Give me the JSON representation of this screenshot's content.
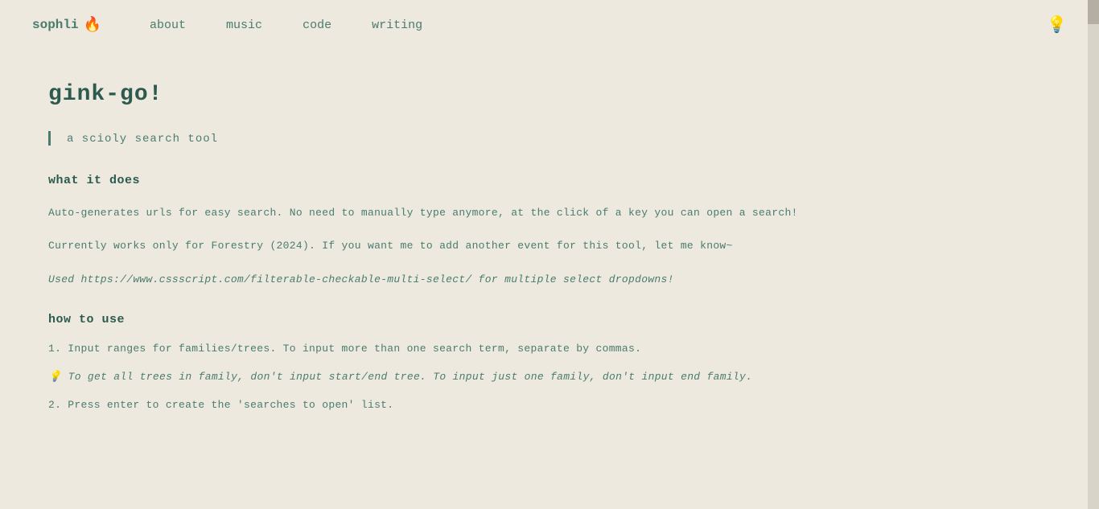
{
  "nav": {
    "brand": "sophli",
    "brand_emoji": "🔥",
    "links": [
      {
        "label": "about",
        "href": "#about"
      },
      {
        "label": "music",
        "href": "#music"
      },
      {
        "label": "code",
        "href": "#code"
      },
      {
        "label": "writing",
        "href": "#writing"
      }
    ],
    "theme_icon": "💡"
  },
  "page": {
    "title": "gink-go!",
    "subtitle": "a scioly search tool",
    "sections": [
      {
        "heading": "what it does",
        "paragraphs": [
          "Auto-generates urls for easy search. No need to manually type anymore, at the click of a key you can open a search!",
          "Currently works only for Forestry (2024). If you want me to add another event for this tool, let me know~",
          "Used https://www.cssscript.com/filterable-checkable-multi-select/ for multiple select dropdowns!"
        ]
      },
      {
        "heading": "how to use",
        "steps": [
          "1. Input ranges for families/trees. To input more than one search term, separate by commas.",
          "2. Press enter to create the 'searches to open' list."
        ],
        "tip": "💡  To get all trees in family, don't input start/end tree. To input just one family, don't input end family."
      }
    ]
  }
}
